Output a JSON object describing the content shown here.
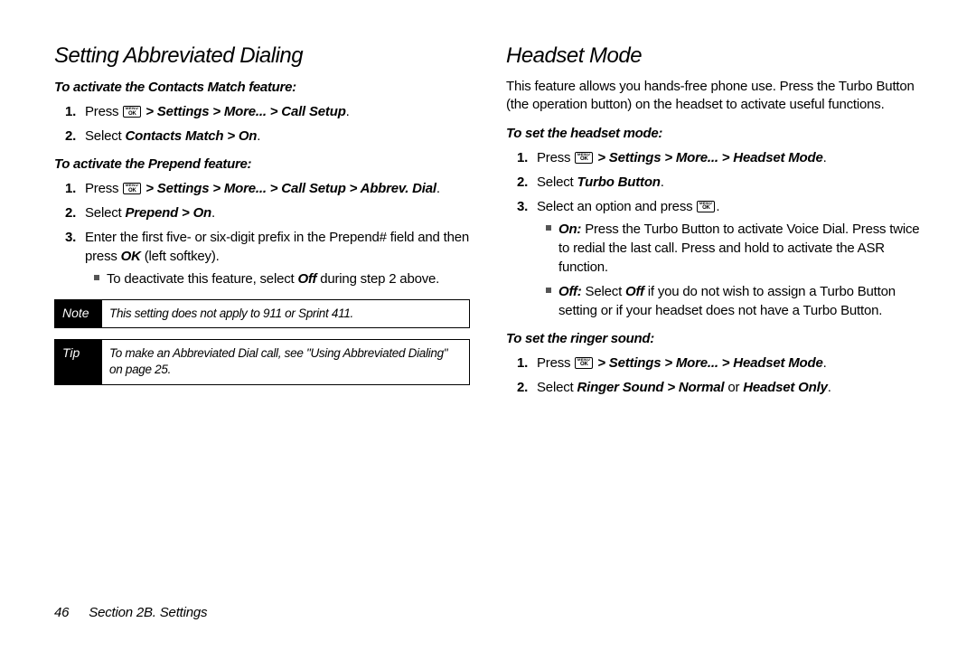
{
  "left": {
    "title": "Setting Abbreviated Dialing",
    "sub1": "To activate the Contacts Match feature:",
    "s1_1a": "Press ",
    "s1_1b": " > Settings > More... > Call Setup",
    "s1_2a": "Select ",
    "s1_2b": "Contacts Match > On",
    "sub2": "To activate the Prepend feature:",
    "s2_1a": "Press ",
    "s2_1b": " > Settings > More... > Call Setup > Abbrev. Dial",
    "s2_2a": "Select ",
    "s2_2b": "Prepend > On",
    "s2_3a": "Enter the first five- or six-digit prefix in the Prepend# field and then press ",
    "s2_3b": "OK",
    "s2_3c": " (left softkey).",
    "s2_b1a": "To deactivate this feature, select ",
    "s2_b1b": "Off",
    "s2_b1c": " during step 2 above.",
    "note_label": "Note",
    "note_text": "This setting does not apply to 911 or Sprint 411.",
    "tip_label": "Tip",
    "tip_text": "To make an Abbreviated Dial call, see \"Using Abbreviated Dialing\" on page 25."
  },
  "right": {
    "title": "Headset Mode",
    "intro": "This feature allows you hands-free phone use. Press the Turbo Button (the operation button) on the headset to activate useful functions.",
    "sub1": "To set the headset mode:",
    "r1_1a": "Press ",
    "r1_1b": " > Settings > More... > Headset Mode",
    "r1_2a": "Select ",
    "r1_2b": "Turbo Button",
    "r1_3a": "Select an option and press ",
    "rb1a": "On:",
    "rb1b": " Press the Turbo Button to activate Voice Dial. Press twice to redial the last call. Press and hold to activate the ASR function.",
    "rb2a": "Off:",
    "rb2b": " Select ",
    "rb2c": "Off",
    "rb2d": " if you do not wish to assign a Turbo Button setting or if your headset does not have a Turbo Button.",
    "sub2": "To set the ringer sound:",
    "r2_1a": "Press ",
    "r2_1b": " > Settings > More... > Headset Mode",
    "r2_2a": "Select ",
    "r2_2b": "Ringer Sound > Normal",
    "r2_2c": " or ",
    "r2_2d": "Headset Only"
  },
  "footer": {
    "page": "46",
    "section": "Section 2B. Settings"
  },
  "period": "."
}
